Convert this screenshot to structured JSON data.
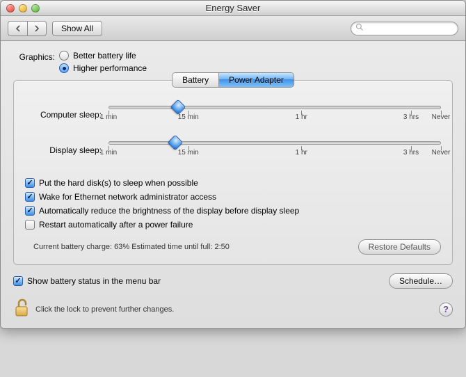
{
  "window": {
    "title": "Energy Saver"
  },
  "toolbar": {
    "show_all": "Show All",
    "search_placeholder": ""
  },
  "graphics": {
    "label": "Graphics:",
    "options": [
      {
        "label": "Better battery life",
        "selected": false
      },
      {
        "label": "Higher performance",
        "selected": true
      }
    ]
  },
  "tabs": [
    {
      "label": "Battery",
      "selected": false
    },
    {
      "label": "Power Adapter",
      "selected": true
    }
  ],
  "sliders": {
    "computer": {
      "label": "Computer sleep:",
      "position_pct": 21
    },
    "display": {
      "label": "Display sleep:",
      "position_pct": 20
    },
    "ticks": [
      {
        "label": "1 min",
        "pct": 0
      },
      {
        "label": "15 min",
        "pct": 24
      },
      {
        "label": "1 hr",
        "pct": 58
      },
      {
        "label": "3 hrs",
        "pct": 91
      },
      {
        "label": "Never",
        "pct": 100
      }
    ]
  },
  "checks": [
    {
      "key": "hdsleep",
      "label": "Put the hard disk(s) to sleep when possible",
      "checked": true
    },
    {
      "key": "wakenet",
      "label": "Wake for Ethernet network administrator access",
      "checked": true
    },
    {
      "key": "dimBefore",
      "label": "Automatically reduce the brightness of the display before display sleep",
      "checked": true
    },
    {
      "key": "restart",
      "label": "Restart automatically after a power failure",
      "checked": false
    }
  ],
  "status": {
    "text": "Current battery charge: 63%  Estimated time until full: 2:50",
    "restore": "Restore Defaults"
  },
  "menubar_check": {
    "label": "Show battery status in the menu bar",
    "checked": true
  },
  "schedule": "Schedule…",
  "lock_text": "Click the lock to prevent further changes.",
  "help": "?"
}
